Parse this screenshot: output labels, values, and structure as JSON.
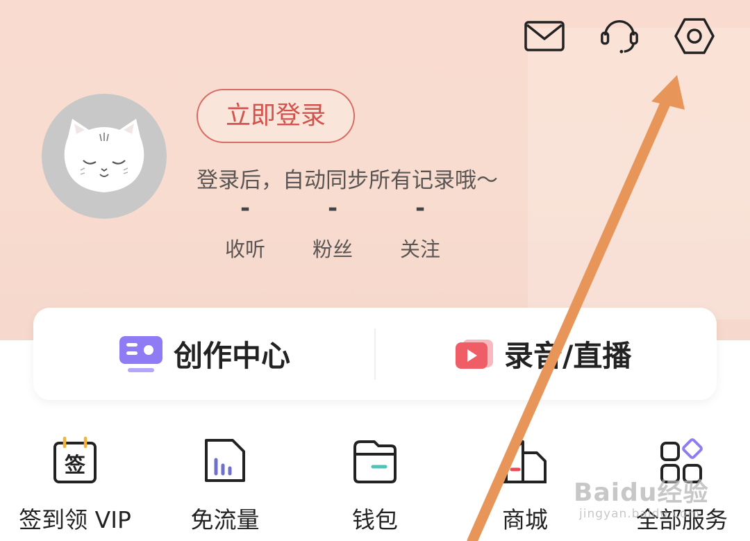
{
  "header": {
    "icons": [
      "mail-icon",
      "headset-icon",
      "settings-icon"
    ]
  },
  "profile": {
    "login_button": "立即登录",
    "subtitle": "登录后，自动同步所有记录哦～",
    "stats": [
      {
        "value": "-",
        "label": "收听"
      },
      {
        "value": "-",
        "label": "粉丝"
      },
      {
        "value": "-",
        "label": "关注"
      }
    ]
  },
  "creator_card": {
    "left_label": "创作中心",
    "right_label": "录音/直播"
  },
  "services": [
    {
      "label": "签到领 VIP",
      "icon": "checkin-icon",
      "icon_text": "签"
    },
    {
      "label": "免流量",
      "icon": "data-free-icon"
    },
    {
      "label": "钱包",
      "icon": "wallet-icon"
    },
    {
      "label": "商城",
      "icon": "store-icon"
    },
    {
      "label": "全部服务",
      "icon": "all-services-icon"
    }
  ],
  "watermark": {
    "logo": "Baidu经验",
    "sub": "jingyan.baidu.com"
  },
  "colors": {
    "accent": "#d2524c",
    "annotation_arrow": "#e8955a",
    "header_bg": "#f9dccf"
  }
}
